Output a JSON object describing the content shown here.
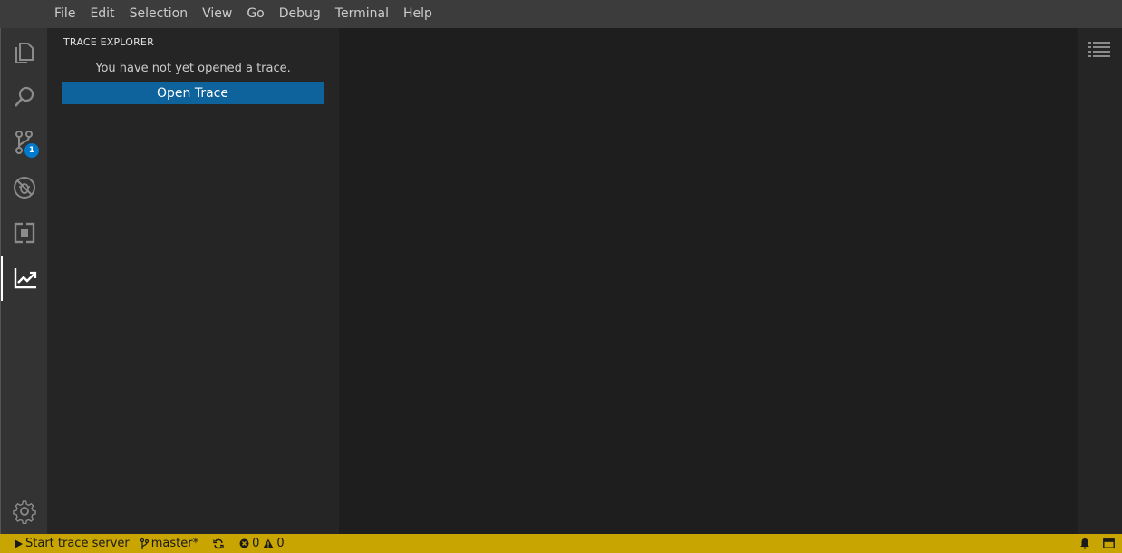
{
  "menubar": {
    "items": [
      "File",
      "Edit",
      "Selection",
      "View",
      "Go",
      "Debug",
      "Terminal",
      "Help"
    ]
  },
  "activitybar": {
    "items": [
      {
        "name": "explorer",
        "icon": "files-icon"
      },
      {
        "name": "search",
        "icon": "search-icon"
      },
      {
        "name": "source-control",
        "icon": "source-control-icon",
        "badge": "1"
      },
      {
        "name": "debug",
        "icon": "debug-icon"
      },
      {
        "name": "extensions",
        "icon": "extensions-icon"
      },
      {
        "name": "trace-viewer",
        "icon": "trace-chart-icon",
        "active": true
      }
    ],
    "settings_icon": "gear-icon"
  },
  "sidebar": {
    "title": "TRACE EXPLORER",
    "empty_message": "You have not yet opened a trace.",
    "open_button_label": "Open Trace"
  },
  "rightpanel": {
    "icon": "outline-list-icon"
  },
  "statusbar": {
    "start_server": "Start trace server",
    "branch": "master*",
    "errors": "0",
    "warnings": "0"
  },
  "colors": {
    "statusbar_bg": "#c8a500",
    "button_bg": "#0e639c",
    "badge_bg": "#007acc"
  }
}
